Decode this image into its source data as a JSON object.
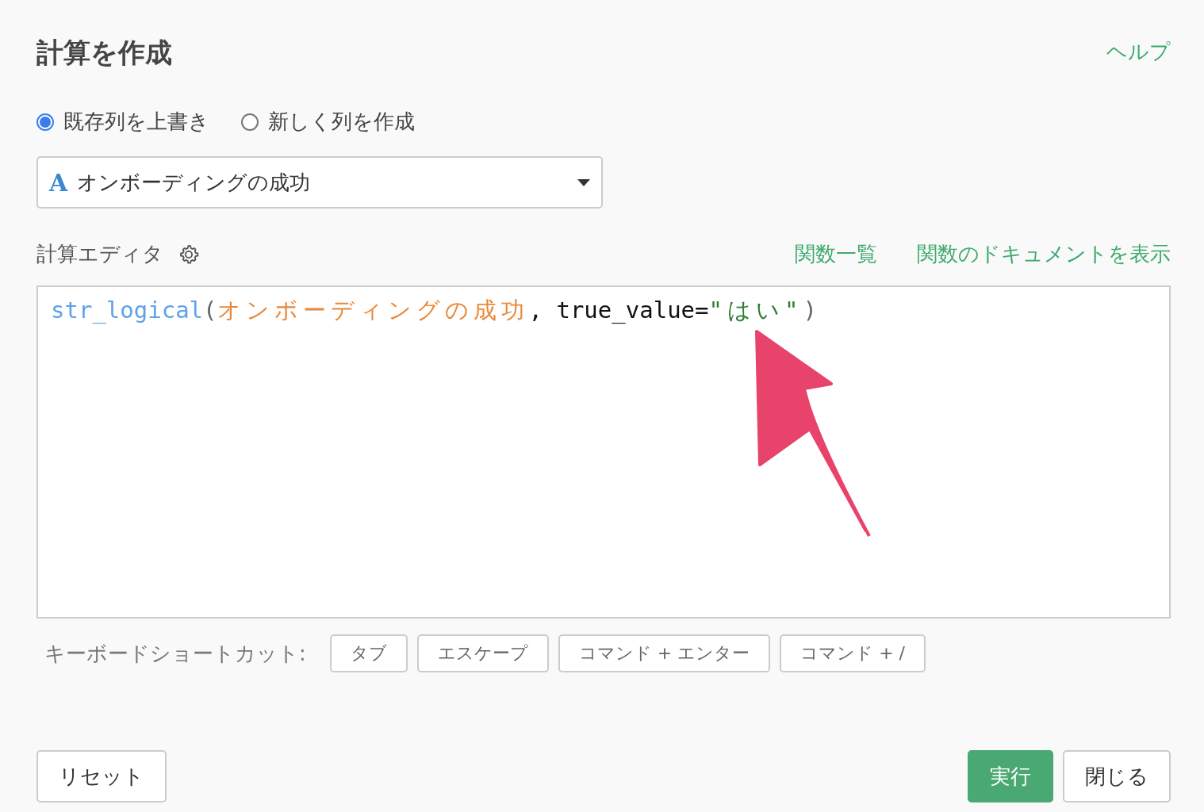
{
  "title": "計算を作成",
  "help_link": "ヘルプ",
  "mode_options": [
    {
      "label": "既存列を上書き",
      "selected": true
    },
    {
      "label": "新しく列を作成",
      "selected": false
    }
  ],
  "column_select": {
    "type_icon": "A",
    "value": "オンボーディングの成功"
  },
  "editor": {
    "label": "計算エディタ",
    "links": [
      "関数一覧",
      "関数のドキュメントを表示"
    ],
    "code": [
      {
        "kind": "function",
        "text": "str_logical"
      },
      {
        "kind": "paren",
        "text": "("
      },
      {
        "kind": "column",
        "text": "オンボーディングの成功"
      },
      {
        "kind": "plain",
        "text": ", true_value="
      },
      {
        "kind": "string",
        "text": "\"はい\""
      },
      {
        "kind": "paren",
        "text": ")"
      }
    ]
  },
  "shortcuts": {
    "label": "キーボードショートカット:",
    "keys": [
      "タブ",
      "エスケープ",
      "コマンド + エンター",
      "コマンド + /"
    ]
  },
  "footer": {
    "reset": "リセット",
    "run": "実行",
    "close": "閉じる"
  }
}
